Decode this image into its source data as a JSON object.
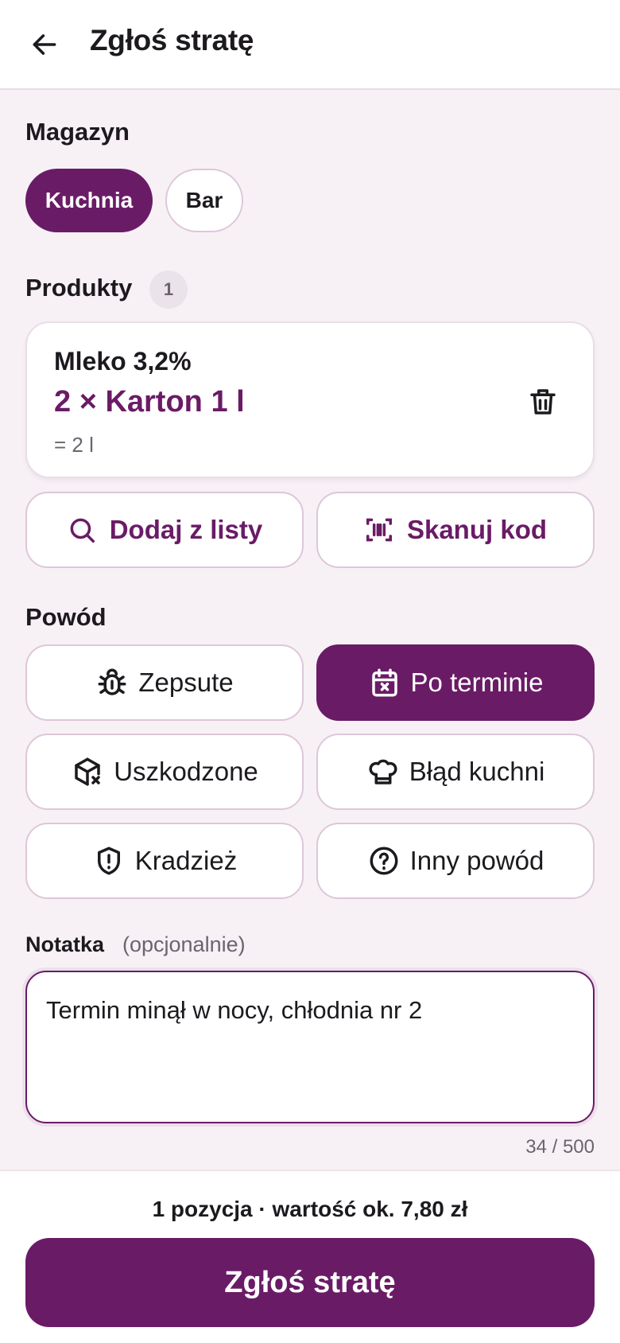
{
  "header": {
    "title": "Zgłoś stratę",
    "back_icon": "arrow-left-icon"
  },
  "warehouse": {
    "label": "Magazyn",
    "options": [
      {
        "label": "Kuchnia",
        "selected": true
      },
      {
        "label": "Bar",
        "selected": false
      }
    ]
  },
  "products": {
    "label": "Produkty",
    "count": "1",
    "items": [
      {
        "name": "Mleko 3,2%",
        "quantity": "2 × Karton 1 l",
        "total": "= 2 l"
      }
    ],
    "add_from_list": "Dodaj z listy",
    "scan_code": "Skanuj kod"
  },
  "reason": {
    "label": "Powód",
    "options": [
      {
        "label": "Zepsute",
        "icon": "bug-icon",
        "selected": false
      },
      {
        "label": "Po terminie",
        "icon": "calendar-x-icon",
        "selected": true
      },
      {
        "label": "Uszkodzone",
        "icon": "damaged-box-icon",
        "selected": false
      },
      {
        "label": "Błąd kuchni",
        "icon": "chef-hat-icon",
        "selected": false
      },
      {
        "label": "Kradzież",
        "icon": "shield-alert-icon",
        "selected": false
      },
      {
        "label": "Inny powód",
        "icon": "question-circle-icon",
        "selected": false
      }
    ]
  },
  "note": {
    "label": "Notatka",
    "optional": "(opcjonalnie)",
    "value": "Termin minął w nocy, chłodnia nr 2",
    "char_count": "34 / 500"
  },
  "footer": {
    "summary": "1 pozycja · wartość ok. 7,80 zł",
    "submit_label": "Zgłoś stratę"
  },
  "colors": {
    "accent": "#6a1b66",
    "background": "#f7f1f6",
    "border": "#ddc7d9"
  }
}
